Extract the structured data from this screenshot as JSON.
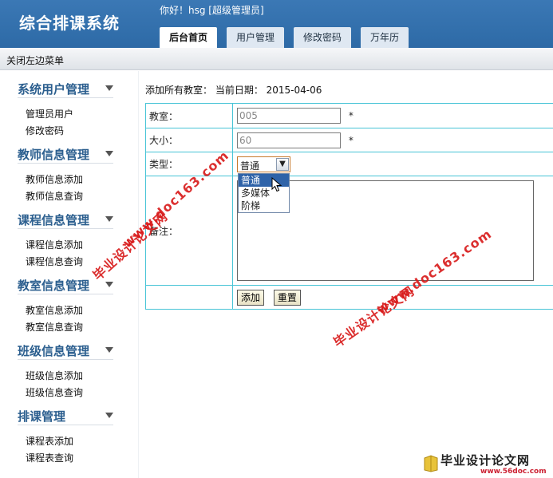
{
  "app": {
    "title": "综合排课系统",
    "greeting": "你好！hsg [超级管理员]"
  },
  "tabs": [
    {
      "label": "后台首页",
      "active": true
    },
    {
      "label": "用户管理"
    },
    {
      "label": "修改密码"
    },
    {
      "label": "万年历"
    }
  ],
  "toolbar": {
    "toggle_menu": "关闭左边菜单"
  },
  "sidebar": {
    "sections": [
      {
        "title": "系统用户管理",
        "items": [
          "管理员用户",
          "修改密码"
        ]
      },
      {
        "title": "教师信息管理",
        "items": [
          "教师信息添加",
          "教师信息查询"
        ]
      },
      {
        "title": "课程信息管理",
        "items": [
          "课程信息添加",
          "课程信息查询"
        ]
      },
      {
        "title": "教室信息管理",
        "items": [
          "教室信息添加",
          "教室信息查询"
        ]
      },
      {
        "title": "班级信息管理",
        "items": [
          "班级信息添加",
          "班级信息查询"
        ]
      },
      {
        "title": "排课管理",
        "items": [
          "课程表添加",
          "课程表查询"
        ]
      }
    ]
  },
  "main": {
    "breadcrumb": "添加所有教室： 当前日期： 2015-04-06",
    "form": {
      "room_label": "教室：",
      "room_value": "005",
      "size_label": "大小：",
      "size_value": "60",
      "type_label": "类型：",
      "type_selected": "普通",
      "type_options": [
        "普通",
        "多媒体",
        "阶梯"
      ],
      "remarks_label": "备注：",
      "required_mark": "*",
      "add_button": "添加",
      "reset_button": "重置"
    }
  },
  "watermarks": {
    "text1": "毕业设计论文网",
    "text2": "www.doc163.com"
  },
  "footer_logo": {
    "text": "毕业设计论文网",
    "url": "www.56doc.com"
  },
  "colors": {
    "header": "#2d6aa6",
    "section_title": "#2c5f8f",
    "table_border": "#47c4d6",
    "watermark": "#d81818",
    "dropdown_selected": "#2f63a8"
  }
}
